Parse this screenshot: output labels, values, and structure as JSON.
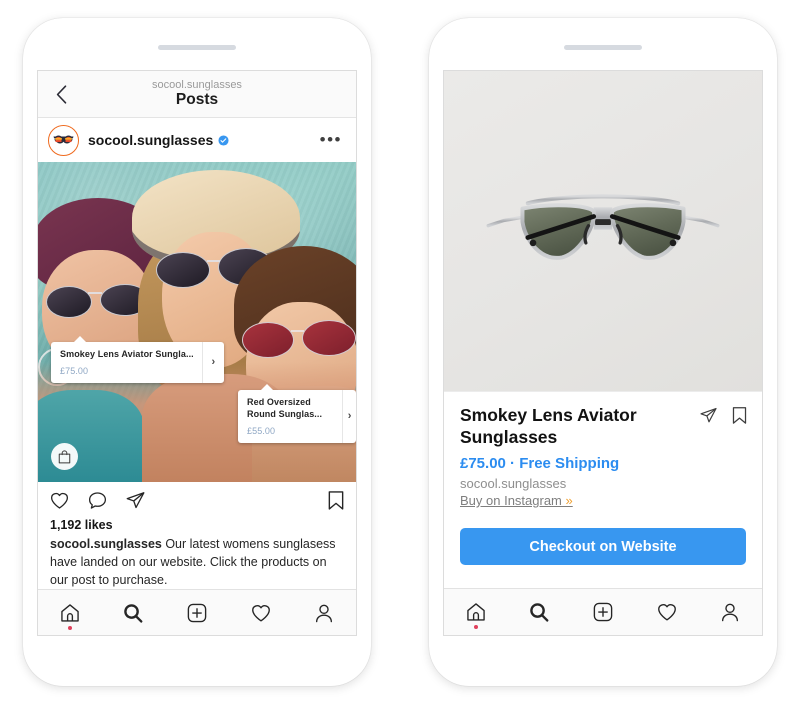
{
  "left_phone": {
    "header": {
      "back_icon": "chevron-left-icon",
      "subtitle": "socool.sunglasses",
      "title": "Posts"
    },
    "post": {
      "avatar_icon": "sunglasses-avatar",
      "username": "socool.sunglasses",
      "verified_icon": "verified-badge-icon",
      "more_icon": "more-options-icon",
      "shopping_bag_icon": "shopping-bag-icon",
      "tags": [
        {
          "title": "Smokey Lens Aviator Sungla...",
          "price": "£75.00",
          "arrow": "›"
        },
        {
          "title": "Red Oversized Round Sunglas...",
          "price": "£55.00",
          "arrow": "›"
        }
      ],
      "actions": {
        "like_icon": "heart-icon",
        "comment_icon": "comment-icon",
        "share_icon": "share-icon",
        "save_icon": "bookmark-icon"
      },
      "likes": "1,192 likes",
      "caption_author": "socool.sunglasses",
      "caption_text": " Our latest womens sunglasess have landed on our website. Click the products on our post to purchase."
    }
  },
  "right_phone": {
    "product": {
      "image_alt": "aviator-sunglasses-product-photo",
      "title": "Smokey Lens Aviator Sunglasses",
      "price": "£75.00 · Free Shipping",
      "seller": "socool.sunglasses",
      "buy_link": "Buy on Instagram ",
      "buy_link_chevron": "»",
      "share_icon": "share-icon",
      "save_icon": "bookmark-icon",
      "checkout_label": "Checkout on Website"
    }
  },
  "tabbar": {
    "items": [
      {
        "icon": "home-icon",
        "has_dot": true
      },
      {
        "icon": "search-icon",
        "has_dot": false
      },
      {
        "icon": "add-post-icon",
        "has_dot": false
      },
      {
        "icon": "activity-heart-icon",
        "has_dot": false
      },
      {
        "icon": "profile-icon",
        "has_dot": false
      }
    ]
  },
  "colors": {
    "accent_blue": "#3897f0",
    "price_blue": "#2b8cf0",
    "tag_price": "#8fa7c4",
    "notification_dot": "#e0405c",
    "avatar_ring": "#ef6a1e"
  }
}
